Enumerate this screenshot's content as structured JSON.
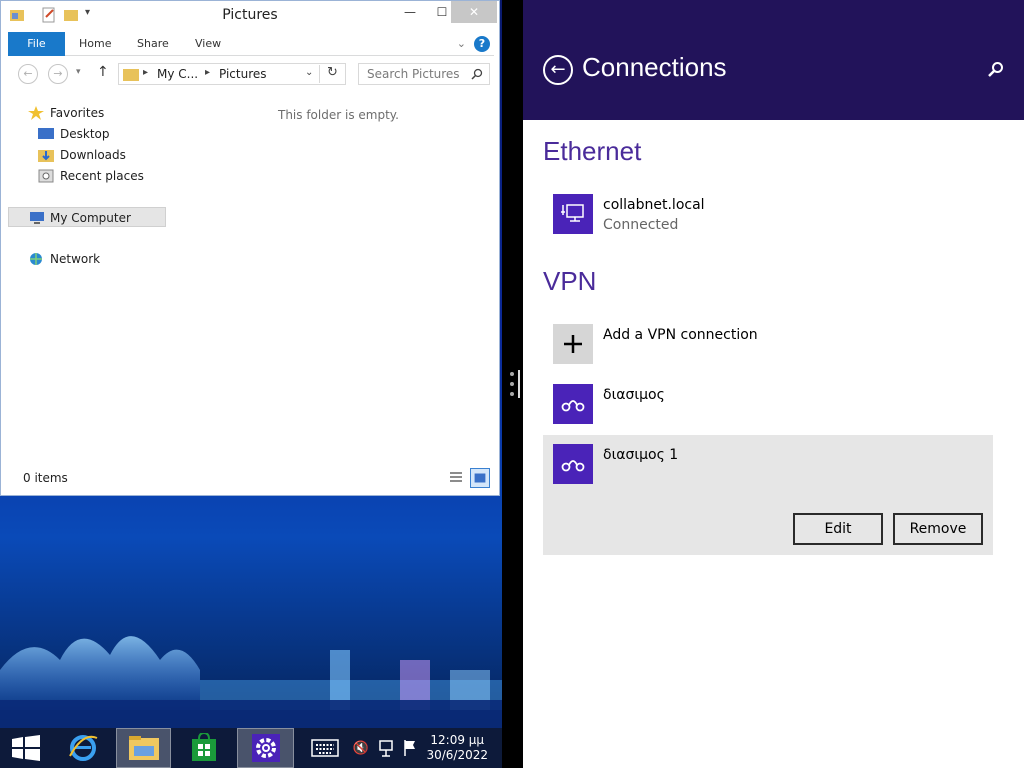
{
  "explorer": {
    "title": "Pictures",
    "ribbon_tabs": [
      "File",
      "Home",
      "Share",
      "View"
    ],
    "address": {
      "parent": "My C...",
      "current": "Pictures"
    },
    "search_placeholder": "Search Pictures",
    "nav": {
      "favorites": "Favorites",
      "desktop": "Desktop",
      "downloads": "Downloads",
      "recent": "Recent places",
      "computer": "My Computer",
      "network": "Network"
    },
    "empty_message": "This folder is empty.",
    "status": "0 items"
  },
  "taskbar": {
    "time": "12:09 μμ",
    "date": "30/6/2022"
  },
  "settings": {
    "title": "Connections",
    "ethernet_header": "Ethernet",
    "ethernet": {
      "name": "collabnet.local",
      "status": "Connected"
    },
    "vpn_header": "VPN",
    "add_vpn": "Add a VPN connection",
    "vpn_items": [
      "διασιμος",
      "διασιμος 1"
    ],
    "edit_label": "Edit",
    "remove_label": "Remove"
  },
  "colors": {
    "header_bg": "#22135a",
    "accent": "#4a23b8",
    "section_text": "#4a2b9a"
  }
}
